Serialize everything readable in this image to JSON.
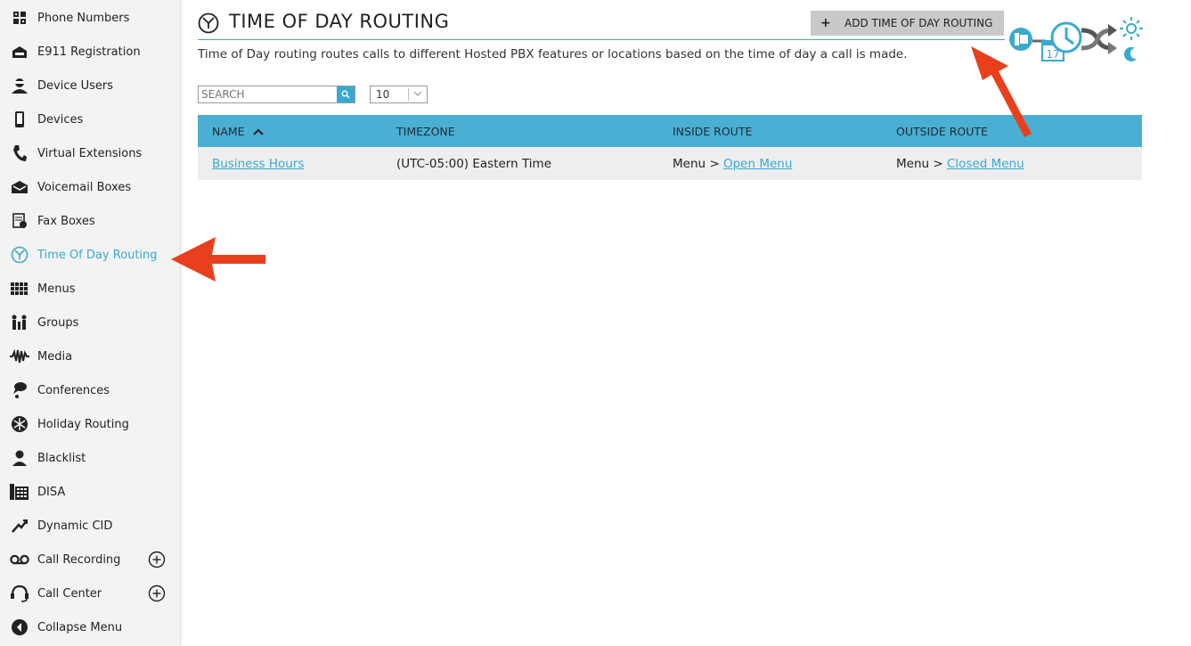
{
  "sidebar": {
    "items": [
      {
        "label": "Phone Numbers",
        "icon": "phone-numbers-icon"
      },
      {
        "label": "E911 Registration",
        "icon": "e911-icon"
      },
      {
        "label": "Device Users",
        "icon": "device-users-icon"
      },
      {
        "label": "Devices",
        "icon": "devices-icon"
      },
      {
        "label": "Virtual Extensions",
        "icon": "virtual-extensions-icon"
      },
      {
        "label": "Voicemail Boxes",
        "icon": "voicemail-icon"
      },
      {
        "label": "Fax Boxes",
        "icon": "fax-icon"
      },
      {
        "label": "Time Of Day Routing",
        "icon": "clock-icon",
        "active": true
      },
      {
        "label": "Menus",
        "icon": "menus-icon"
      },
      {
        "label": "Groups",
        "icon": "groups-icon"
      },
      {
        "label": "Media",
        "icon": "media-icon"
      },
      {
        "label": "Conferences",
        "icon": "conferences-icon"
      },
      {
        "label": "Holiday Routing",
        "icon": "snowflake-icon"
      },
      {
        "label": "Blacklist",
        "icon": "blacklist-icon"
      },
      {
        "label": "DISA",
        "icon": "disa-icon"
      },
      {
        "label": "Dynamic CID",
        "icon": "dynamic-cid-icon"
      },
      {
        "label": "Call Recording",
        "icon": "call-recording-icon",
        "expandable": true
      },
      {
        "label": "Call Center",
        "icon": "headset-icon",
        "expandable": true
      },
      {
        "label": "Collapse Menu",
        "icon": "collapse-icon"
      }
    ]
  },
  "header": {
    "title": "TIME OF DAY ROUTING",
    "add_button_label": "ADD TIME OF DAY ROUTING",
    "add_button_symbol": "+",
    "description": "Time of Day routing routes calls to different Hosted PBX features or locations based on the time of day a call is made."
  },
  "toolbar": {
    "search_placeholder": "SEARCH",
    "page_size": "10"
  },
  "table": {
    "columns": [
      "NAME",
      "TIMEZONE",
      "INSIDE ROUTE",
      "OUTSIDE ROUTE"
    ],
    "rows": [
      {
        "name": "Business Hours",
        "timezone": "(UTC-05:00) Eastern Time",
        "inside_prefix": "Menu > ",
        "inside_link": "Open Menu",
        "outside_prefix": "Menu > ",
        "outside_link": "Closed Menu"
      }
    ]
  },
  "graphic": {
    "calendar_day": "17"
  },
  "colors": {
    "accent": "#3aa9cf",
    "header_bg": "#4aafd3",
    "annotation_arrow": "#e8401c",
    "button_bg": "#c9c9c9"
  }
}
